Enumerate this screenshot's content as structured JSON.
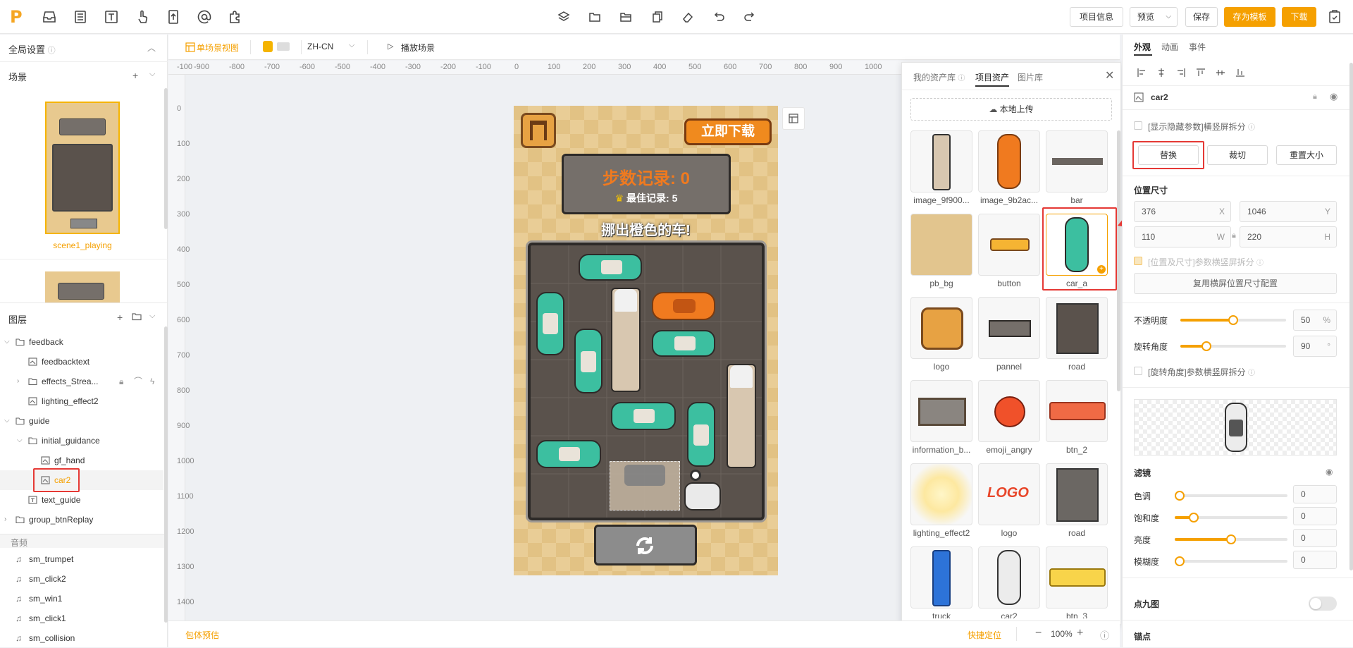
{
  "topbar": {
    "project_info": "项目信息",
    "preview": "预览",
    "save": "保存",
    "save_template": "存为模板",
    "download": "下载"
  },
  "left": {
    "global_settings": "全局设置",
    "scene_title": "场景",
    "scene_name": "scene1_playing",
    "layers_title": "图层",
    "layers": [
      {
        "label": "feedback"
      },
      {
        "label": "feedbacktext"
      },
      {
        "label": "effects_Strea..."
      },
      {
        "label": "lighting_effect2"
      },
      {
        "label": "guide"
      },
      {
        "label": "initial_guidance"
      },
      {
        "label": "gf_hand"
      },
      {
        "label": "car2"
      },
      {
        "label": "text_guide"
      },
      {
        "label": "group_btnReplay"
      }
    ],
    "audio_title": "音频",
    "audio": [
      "sm_trumpet",
      "sm_click2",
      "sm_win1",
      "sm_click1",
      "sm_collision"
    ]
  },
  "toolbar2": {
    "single_scene_view": "单场景视图",
    "language": "ZH-CN",
    "play_scene": "播放场景"
  },
  "ruler": {
    "h": [
      "-100",
      "-900",
      "-800",
      "-700",
      "-600",
      "-500",
      "-400",
      "-300",
      "-200",
      "-100",
      "0",
      "100",
      "200",
      "300",
      "400",
      "500",
      "600",
      "700",
      "800",
      "900",
      "1000"
    ],
    "v": [
      "0",
      "100",
      "200",
      "300",
      "400",
      "500",
      "600",
      "700",
      "800",
      "900",
      "1000",
      "1100",
      "1200",
      "1300",
      "1400"
    ]
  },
  "game": {
    "download_btn": "立即下载",
    "steps_label": "步数记录: 0",
    "best_label": "最佳记录: 5",
    "instruction": "挪出橙色的车!"
  },
  "bottom": {
    "package_estimate": "包体预估",
    "quick_locate": "快捷定位",
    "zoom": "100%",
    "minus": "−",
    "plus": "+"
  },
  "assets": {
    "tabs": [
      "我的资产库",
      "项目资产",
      "图片库"
    ],
    "upload": "本地上传",
    "items": [
      {
        "name": "image_9f900..."
      },
      {
        "name": "image_9b2ac..."
      },
      {
        "name": "bar"
      },
      {
        "name": "pb_bg"
      },
      {
        "name": "button"
      },
      {
        "name": "car_a"
      },
      {
        "name": "logo"
      },
      {
        "name": "pannel"
      },
      {
        "name": "road"
      },
      {
        "name": "information_b..."
      },
      {
        "name": "emoji_angry"
      },
      {
        "name": "btn_2"
      },
      {
        "name": "lighting_effect2"
      },
      {
        "name": "logo"
      },
      {
        "name": "road"
      },
      {
        "name": "truck"
      },
      {
        "name": "car2"
      },
      {
        "name": "btn_3"
      }
    ],
    "logo_text": "LOGO"
  },
  "right": {
    "tabs": [
      "外观",
      "动画",
      "事件"
    ],
    "layer_name": "car2",
    "show_hidden": "[显示隐藏参数]横竖屏拆分",
    "replace": "替换",
    "crop": "裁切",
    "reset_size": "重置大小",
    "position_size": "位置尺寸",
    "x": "376",
    "x_unit": "X",
    "y": "1046",
    "y_unit": "Y",
    "w": "110",
    "w_unit": "W",
    "h": "220",
    "h_unit": "H",
    "pos_split": "[位置及尺寸]参数横竖屏拆分",
    "reuse_landscape": "复用横屏位置尺寸配置",
    "opacity_label": "不透明度",
    "opacity": "50",
    "opacity_unit": "%",
    "rotation_label": "旋转角度",
    "rotation": "90",
    "rotation_unit": "°",
    "rotation_split": "[旋转角度]参数横竖屏拆分",
    "filter_title": "滤镜",
    "hue_label": "色调",
    "hue": "0",
    "saturation_label": "饱和度",
    "saturation": "0",
    "brightness_label": "亮度",
    "brightness": "0",
    "blur_label": "模糊度",
    "blur": "0",
    "nine_patch": "点九图",
    "anchor": "锚点"
  },
  "colors": {
    "accent": "#f5a000",
    "highlight_red": "#e53935",
    "car_teal": "#3cbfa0",
    "car_orange": "#f07a1f"
  }
}
